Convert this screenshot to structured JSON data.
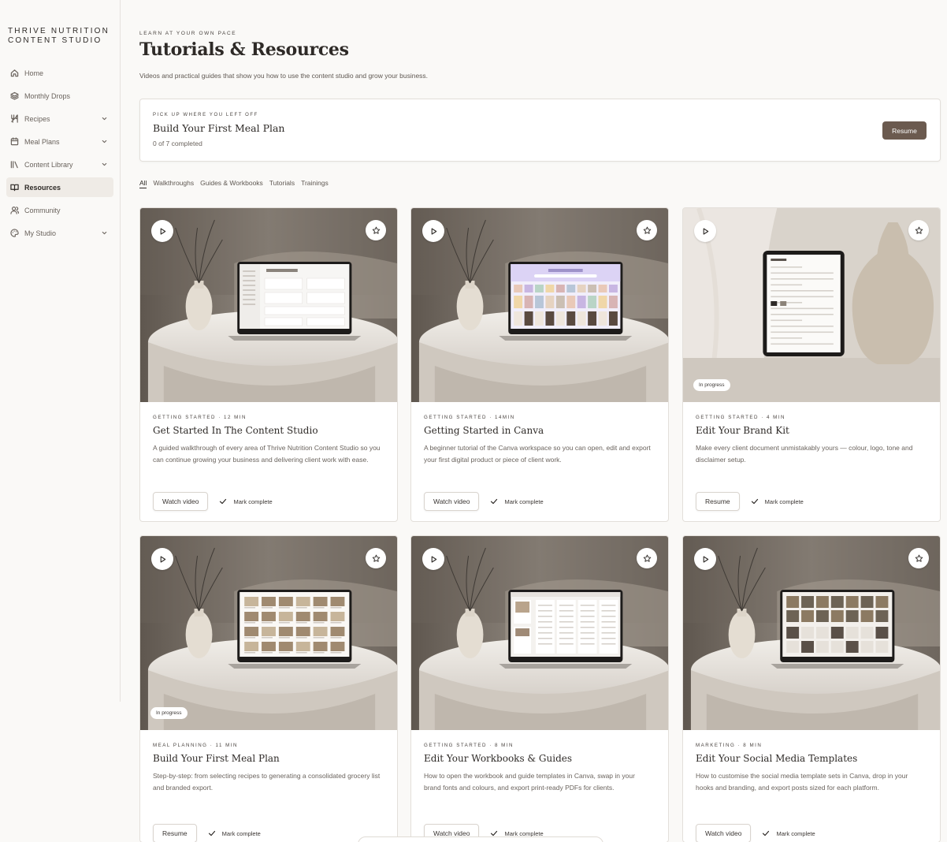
{
  "brand": {
    "line1": "THRIVE NUTRITION",
    "line2": "CONTENT STUDIO"
  },
  "sidebar": {
    "items": [
      {
        "label": "Home",
        "icon": "home-icon",
        "chevron": false
      },
      {
        "label": "Monthly Drops",
        "icon": "layers-icon",
        "chevron": false
      },
      {
        "label": "Recipes",
        "icon": "utensils-icon",
        "chevron": true
      },
      {
        "label": "Meal Plans",
        "icon": "calendar-icon",
        "chevron": true
      },
      {
        "label": "Content Library",
        "icon": "library-icon",
        "chevron": true
      },
      {
        "label": "Resources",
        "icon": "book-open-icon",
        "chevron": false,
        "active": true
      },
      {
        "label": "Community",
        "icon": "users-icon",
        "chevron": false
      },
      {
        "label": "My Studio",
        "icon": "palette-icon",
        "chevron": true
      }
    ]
  },
  "header": {
    "eyebrow": "LEARN AT YOUR OWN PACE",
    "title": "Tutorials & Resources",
    "subtitle": "Videos and practical guides that show you how to use the content studio and grow your business."
  },
  "resume": {
    "eyebrow": "PICK UP WHERE YOU LEFT OFF",
    "title": "Build Your First Meal Plan",
    "progress": "0 of 7 completed",
    "button": "Resume"
  },
  "filters": [
    "All",
    "Walkthroughs",
    "Guides & Workbooks",
    "Tutorials",
    "Trainings"
  ],
  "cards": [
    {
      "meta": "GETTING STARTED · 12 MIN",
      "title": "Get Started In The Content Studio",
      "desc": "A guided walkthrough of every area of Thrive Nutrition Content Studio so you can continue growing your business and delivering client work with ease.",
      "button": "Watch video",
      "mark": "Mark complete",
      "badge": "",
      "scene": "laptop-dashboard"
    },
    {
      "meta": "GETTING STARTED · 14MIN",
      "title": "Getting Started in Canva",
      "desc": "A beginner tutorial of the Canva workspace so you can open, edit and export your first digital product or piece of client work.",
      "button": "Watch video",
      "mark": "Mark complete",
      "badge": "",
      "scene": "laptop-canva"
    },
    {
      "meta": "GETTING STARTED · 4 MIN",
      "title": "Edit Your Brand Kit",
      "desc": "Make every client document unmistakably yours — colour, logo, tone and disclaimer setup.",
      "button": "Resume",
      "mark": "Mark complete",
      "badge": "In progress",
      "scene": "tablet-brandkit"
    },
    {
      "meta": "MEAL PLANNING · 11 MIN",
      "title": "Build Your First Meal Plan",
      "desc": "Step-by-step: from selecting recipes to generating a consolidated grocery list and branded export.",
      "button": "Resume",
      "mark": "Mark complete",
      "badge": "In progress",
      "scene": "laptop-meals"
    },
    {
      "meta": "GETTING STARTED · 8 MIN",
      "title": "Edit Your Workbooks & Guides",
      "desc": "How to open the workbook and guide templates in Canva, swap in your brand fonts and colours, and export print-ready PDFs for clients.",
      "button": "Watch video",
      "mark": "Mark complete",
      "badge": "",
      "scene": "laptop-workbooks"
    },
    {
      "meta": "MARKETING · 8 MIN",
      "title": "Edit Your Social Media Templates",
      "desc": "How to customise the social media template sets in Canva, drop in your hooks and branding, and export posts sized for each platform.",
      "button": "Watch video",
      "mark": "Mark complete",
      "badge": "",
      "scene": "laptop-social"
    }
  ]
}
